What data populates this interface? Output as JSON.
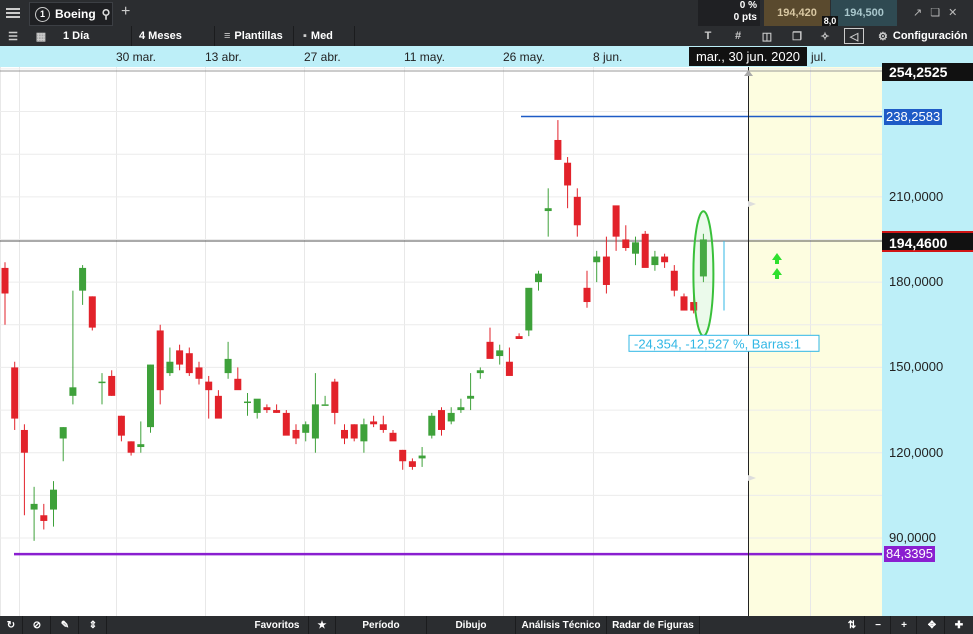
{
  "header": {
    "symbol_number": "1",
    "symbol": "Boeing",
    "change_pct": "0 %",
    "change_pts": "0 pts",
    "bid": "194,420",
    "ask": "194,500",
    "spread": "8,0"
  },
  "toolbar": {
    "interval": "1 Día",
    "range": "4 Meses",
    "templates": "Plantillas",
    "price_mode": "Med",
    "settings": "Configuración",
    "text_tool": "T",
    "colors": {
      "bid_bg": "#5a4a2e",
      "ask_bg": "#2f4a52"
    }
  },
  "bottom_bar": {
    "favorites": "Favoritos",
    "period": "Período",
    "drawing": "Dibujo",
    "technical": "Análisis Técnico",
    "patterns": "Radar de Figuras"
  },
  "chart_data": {
    "type": "candlestick",
    "x_labels": [
      "30 mar.",
      "13 abr.",
      "27 abr.",
      "11 may.",
      "26 may.",
      "8 jun.",
      "jul."
    ],
    "crosshair_date": "mar., 30 jun. 2020",
    "y_tick_labels": [
      "210,0000",
      "180,0000",
      "150,0000",
      "120,0000",
      "90,0000"
    ],
    "y_ticks": [
      210,
      180,
      150,
      120,
      90
    ],
    "ylim": [
      80,
      280
    ],
    "top_price_label": "254,2525",
    "current_price": 194.46,
    "current_price_label": "194,4600",
    "hline_blue": {
      "value": 238.2583,
      "label": "238,2583",
      "color": "#1e5bc6"
    },
    "hline_purple": {
      "value": 84.3395,
      "label": "84,3395",
      "color": "#8a1fd0"
    },
    "measure_label": "-24,354, -12,527 %, Barras:1",
    "up_color": "#3ea13a",
    "down_color": "#e2222a",
    "candles": [
      {
        "o": 185,
        "h": 187,
        "l": 165,
        "c": 176
      },
      {
        "o": 150,
        "h": 152,
        "l": 128,
        "c": 132
      },
      {
        "o": 128,
        "h": 130,
        "l": 98,
        "c": 120
      },
      {
        "o": 100,
        "h": 108,
        "l": 89,
        "c": 102
      },
      {
        "o": 98,
        "h": 102,
        "l": 93,
        "c": 96
      },
      {
        "o": 100,
        "h": 110,
        "l": 94,
        "c": 107
      },
      {
        "o": 125,
        "h": 129,
        "l": 117,
        "c": 129
      },
      {
        "o": 140,
        "h": 177,
        "l": 137,
        "c": 143
      },
      {
        "o": 177,
        "h": 186,
        "l": 172,
        "c": 185
      },
      {
        "o": 175,
        "h": 175,
        "l": 163,
        "c": 164
      },
      {
        "o": 145,
        "h": 148,
        "l": 137,
        "c": 145
      },
      {
        "o": 147,
        "h": 149,
        "l": 140,
        "c": 140
      },
      {
        "o": 133,
        "h": 133,
        "l": 124,
        "c": 126
      },
      {
        "o": 124,
        "h": 124,
        "l": 119,
        "c": 120
      },
      {
        "o": 122,
        "h": 131,
        "l": 120,
        "c": 123
      },
      {
        "o": 129,
        "h": 151,
        "l": 127,
        "c": 151
      },
      {
        "o": 163,
        "h": 165,
        "l": 137,
        "c": 142
      },
      {
        "o": 148,
        "h": 157,
        "l": 147,
        "c": 152
      },
      {
        "o": 156,
        "h": 158,
        "l": 149,
        "c": 151
      },
      {
        "o": 155,
        "h": 157,
        "l": 147,
        "c": 148
      },
      {
        "o": 150,
        "h": 152,
        "l": 144,
        "c": 146
      },
      {
        "o": 145,
        "h": 147,
        "l": 132,
        "c": 142
      },
      {
        "o": 140,
        "h": 142,
        "l": 135,
        "c": 132
      },
      {
        "o": 148,
        "h": 159,
        "l": 146,
        "c": 153
      },
      {
        "o": 146,
        "h": 150,
        "l": 143,
        "c": 142
      },
      {
        "o": 138,
        "h": 141,
        "l": 133,
        "c": 138
      },
      {
        "o": 134,
        "h": 138,
        "l": 132,
        "c": 139
      },
      {
        "o": 136,
        "h": 137,
        "l": 134,
        "c": 135
      },
      {
        "o": 135,
        "h": 137,
        "l": 134,
        "c": 134
      },
      {
        "o": 134,
        "h": 135,
        "l": 129,
        "c": 126
      },
      {
        "o": 128,
        "h": 130,
        "l": 123,
        "c": 125
      },
      {
        "o": 127,
        "h": 131,
        "l": 124,
        "c": 130
      },
      {
        "o": 125,
        "h": 148,
        "l": 120,
        "c": 137
      },
      {
        "o": 137,
        "h": 140,
        "l": 137,
        "c": 137
      },
      {
        "o": 145,
        "h": 146,
        "l": 130,
        "c": 134
      },
      {
        "o": 128,
        "h": 130,
        "l": 123,
        "c": 125
      },
      {
        "o": 130,
        "h": 130,
        "l": 124,
        "c": 125
      },
      {
        "o": 124,
        "h": 132,
        "l": 120,
        "c": 130
      },
      {
        "o": 131,
        "h": 133,
        "l": 129,
        "c": 130
      },
      {
        "o": 130,
        "h": 133,
        "l": 127,
        "c": 128
      },
      {
        "o": 127,
        "h": 128,
        "l": 125,
        "c": 124
      },
      {
        "o": 121,
        "h": 121,
        "l": 114,
        "c": 117
      },
      {
        "o": 117,
        "h": 118,
        "l": 114,
        "c": 115
      },
      {
        "o": 118,
        "h": 122,
        "l": 115,
        "c": 119
      },
      {
        "o": 126,
        "h": 134,
        "l": 125,
        "c": 133
      },
      {
        "o": 135,
        "h": 136,
        "l": 126,
        "c": 128
      },
      {
        "o": 131,
        "h": 136,
        "l": 130,
        "c": 134
      },
      {
        "o": 135,
        "h": 139,
        "l": 134,
        "c": 136
      },
      {
        "o": 139,
        "h": 148,
        "l": 135,
        "c": 140
      },
      {
        "o": 148,
        "h": 150,
        "l": 146,
        "c": 149
      },
      {
        "o": 159,
        "h": 164,
        "l": 155,
        "c": 153
      },
      {
        "o": 154,
        "h": 158,
        "l": 151,
        "c": 156
      },
      {
        "o": 152,
        "h": 157,
        "l": 150,
        "c": 147
      },
      {
        "o": 161,
        "h": 162,
        "l": 160,
        "c": 160
      },
      {
        "o": 163,
        "h": 176,
        "l": 161,
        "c": 178
      },
      {
        "o": 180,
        "h": 184,
        "l": 177,
        "c": 183
      },
      {
        "o": 205,
        "h": 213,
        "l": 196,
        "c": 206
      },
      {
        "o": 230,
        "h": 237,
        "l": 223,
        "c": 223
      },
      {
        "o": 222,
        "h": 224,
        "l": 206,
        "c": 214
      },
      {
        "o": 210,
        "h": 213,
        "l": 196,
        "c": 200
      },
      {
        "o": 178,
        "h": 184,
        "l": 171,
        "c": 173
      },
      {
        "o": 187,
        "h": 191,
        "l": 180,
        "c": 189
      },
      {
        "o": 189,
        "h": 196,
        "l": 176,
        "c": 179
      },
      {
        "o": 207,
        "h": 206,
        "l": 191,
        "c": 196
      },
      {
        "o": 195,
        "h": 200,
        "l": 191,
        "c": 192
      },
      {
        "o": 190,
        "h": 196,
        "l": 186,
        "c": 194
      },
      {
        "o": 197,
        "h": 198,
        "l": 186,
        "c": 185
      },
      {
        "o": 186,
        "h": 191,
        "l": 184,
        "c": 189
      },
      {
        "o": 189,
        "h": 190,
        "l": 185,
        "c": 187
      },
      {
        "o": 184,
        "h": 186,
        "l": 175,
        "c": 177
      },
      {
        "o": 175,
        "h": 176,
        "l": 171,
        "c": 170
      },
      {
        "o": 173,
        "h": 177,
        "l": 169,
        "c": 170
      },
      {
        "o": 182,
        "h": 197,
        "l": 180,
        "c": 195
      }
    ]
  }
}
